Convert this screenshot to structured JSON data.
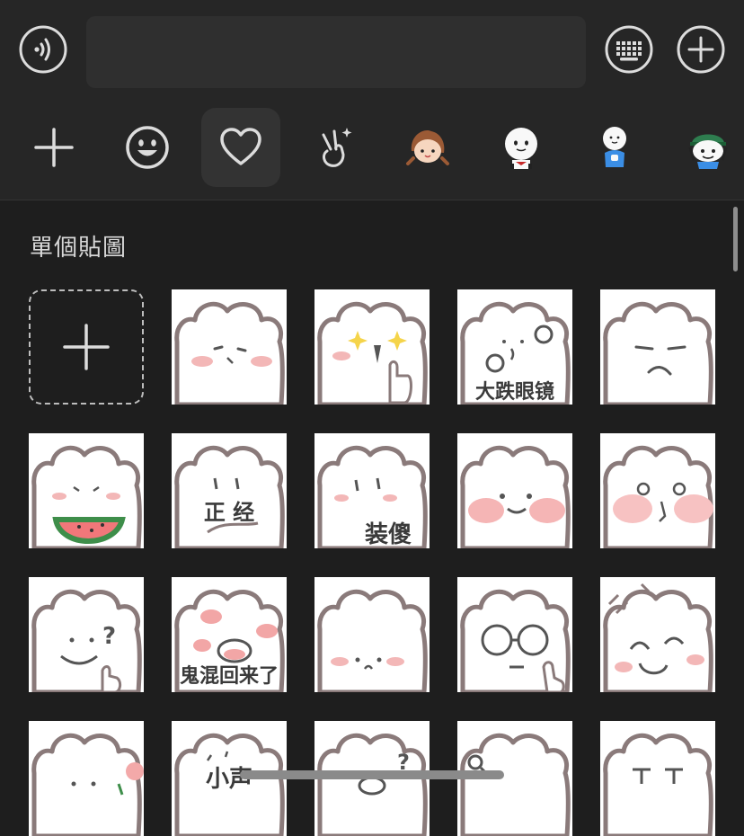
{
  "top_bar": {
    "voice_icon": "voice-wave-icon",
    "keyboard_icon": "keyboard-icon",
    "add_icon": "plus-circle-icon",
    "input_value": ""
  },
  "tabs": [
    {
      "name": "add",
      "icon": "plus-icon"
    },
    {
      "name": "emoji",
      "icon": "smiley-icon"
    },
    {
      "name": "favorites",
      "icon": "heart-icon",
      "active": true
    },
    {
      "name": "gesture",
      "icon": "peace-hand-icon"
    },
    {
      "name": "pack-girl",
      "icon": "girl-sticker-icon"
    },
    {
      "name": "pack-white-face",
      "icon": "white-face-sticker-icon"
    },
    {
      "name": "pack-blue",
      "icon": "blue-figure-sticker-icon"
    },
    {
      "name": "pack-cap",
      "icon": "cap-figure-sticker-icon"
    }
  ],
  "section": {
    "title": "單個貼圖"
  },
  "stickers": {
    "add_tile_icon": "plus-icon",
    "captions": {
      "glasses": "大跌眼镜",
      "serious": "正  经",
      "pretend": "装傻",
      "back": "鬼混回来了",
      "small": "小声"
    }
  },
  "colors": {
    "background": "#1e1e1e",
    "bar": "#262626",
    "active_tab": "#333333"
  }
}
